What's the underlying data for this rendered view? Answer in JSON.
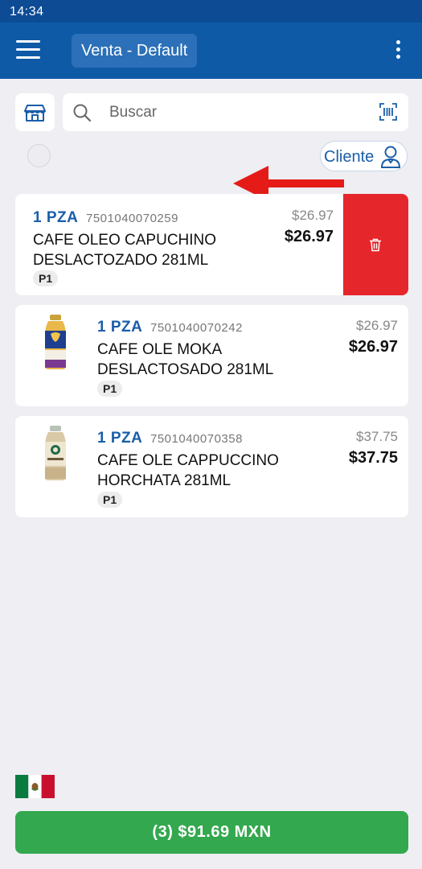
{
  "status_bar": {
    "time": "14:34"
  },
  "app_bar": {
    "title": "Venta - Default",
    "menu_icon": "hamburger-menu-icon",
    "more_icon": "more-vertical-icon"
  },
  "search": {
    "placeholder": "Buscar",
    "value": ""
  },
  "cliente": {
    "label": "Cliente"
  },
  "items": [
    {
      "qty": "1 PZA",
      "sku": "7501040070259",
      "name": "CAFE OLEO CAPUCHINO DESLACTOZADO 281ML",
      "badge": "P1",
      "original_price": "$26.97",
      "price": "$26.97"
    },
    {
      "qty": "1 PZA",
      "sku": "7501040070242",
      "name": "CAFE OLE MOKA DESLACTOSADO 281ML",
      "badge": "P1",
      "original_price": "$26.97",
      "price": "$26.97"
    },
    {
      "qty": "1 PZA",
      "sku": "7501040070358",
      "name": "CAFE OLE CAPPUCCINO HORCHATA 281ML",
      "badge": "P1",
      "original_price": "$37.75",
      "price": "$37.75"
    }
  ],
  "footer": {
    "total_label": "(3) $91.69 MXN",
    "flag": "mexico-flag-icon"
  },
  "colors": {
    "primary": "#0e5aa7",
    "status_bar": "#0d4b95",
    "delete": "#e5262a",
    "checkout": "#33a84e",
    "accent_text": "#1a5ea8"
  }
}
